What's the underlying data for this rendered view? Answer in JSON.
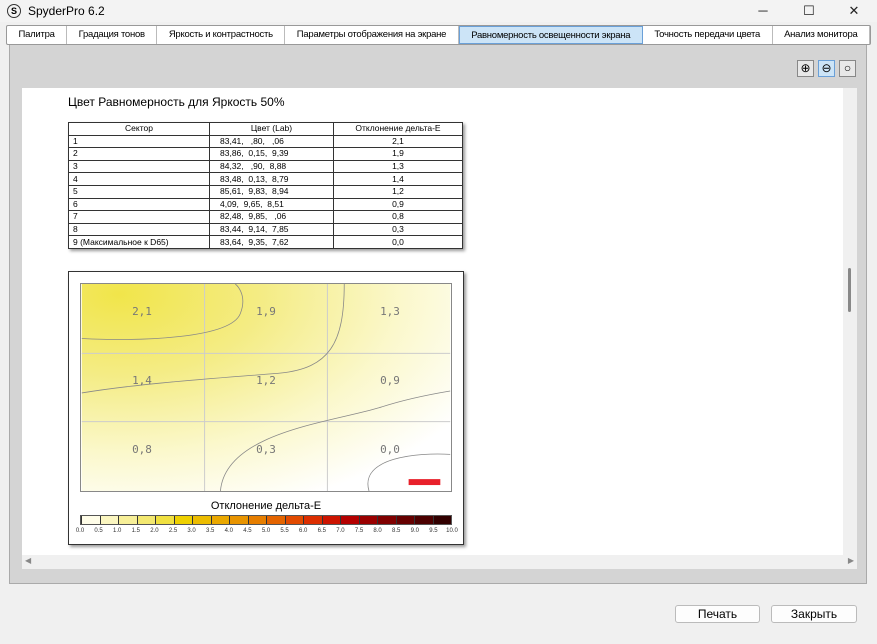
{
  "window": {
    "title": "SpyderPro 6.2",
    "icon": "S"
  },
  "tabs": [
    {
      "label": "Палитра"
    },
    {
      "label": "Градация тонов"
    },
    {
      "label": "Яркость и контрастность"
    },
    {
      "label": "Параметры отображения на экране"
    },
    {
      "label": "Равномерность освещенности экрана",
      "active": true
    },
    {
      "label": "Точность передачи цвета"
    },
    {
      "label": "Анализ монитора"
    }
  ],
  "zoom_icons": [
    "zoom-in-icon",
    "zoom-out-icon",
    "zoom-fit-icon"
  ],
  "report": {
    "title": "Цвет Равномерность для Яркость 50%",
    "table": {
      "headers": [
        "Сектор",
        "Цвет (Lab)",
        "Отклонение дельта-E"
      ],
      "rows": [
        [
          "1",
          "83,41,   ,80,   ,06",
          "2,1"
        ],
        [
          "2",
          "83,86,  0,15,  9,39",
          "1,9"
        ],
        [
          "3",
          "84,32,   ,90,  8,88",
          "1,3"
        ],
        [
          "4",
          "83,48,  0,13,  8,79",
          "1,4"
        ],
        [
          "5",
          "85,61,  9,83,  8,94",
          "1,2"
        ],
        [
          "6",
          "4,09,  9,65,  8,51",
          "0,9"
        ],
        [
          "7",
          "82,48,  9,85,   ,06",
          "0,8"
        ],
        [
          "8",
          "83,44,  9,14,  7,85",
          "0,3"
        ],
        [
          "9 (Максимальное к D65)",
          "83,64,  9,35,  7,62",
          "0,0"
        ]
      ]
    },
    "heatmap": {
      "cells": [
        "2,1",
        "1,9",
        "1,3",
        "1,4",
        "1,2",
        "0,9",
        "0,8",
        "0,3",
        "0,0"
      ],
      "legend_title": "Отклонение дельта-E",
      "scale_ticks": [
        "0.0",
        "0.5",
        "1.0",
        "1.5",
        "2.0",
        "2.5",
        "3.0",
        "3.5",
        "4.0",
        "4.5",
        "5.0",
        "5.5",
        "6.0",
        "6.5",
        "7.0",
        "7.5",
        "8.0",
        "8.5",
        "9.0",
        "9.5",
        "10.0"
      ],
      "scale_colors": [
        "#fffde8",
        "#fbf6c0",
        "#f7ef98",
        "#f3e870",
        "#f0e040",
        "#eed000",
        "#ecbc00",
        "#eaa800",
        "#e89400",
        "#e67e00",
        "#e46400",
        "#e24a00",
        "#dc2e00",
        "#cc1400",
        "#b40000",
        "#9a0000",
        "#800000",
        "#660000",
        "#4c0000",
        "#320000"
      ]
    },
    "marker_color": "#e8202a"
  },
  "buttons": {
    "print": "Печать",
    "close": "Закрыть"
  }
}
